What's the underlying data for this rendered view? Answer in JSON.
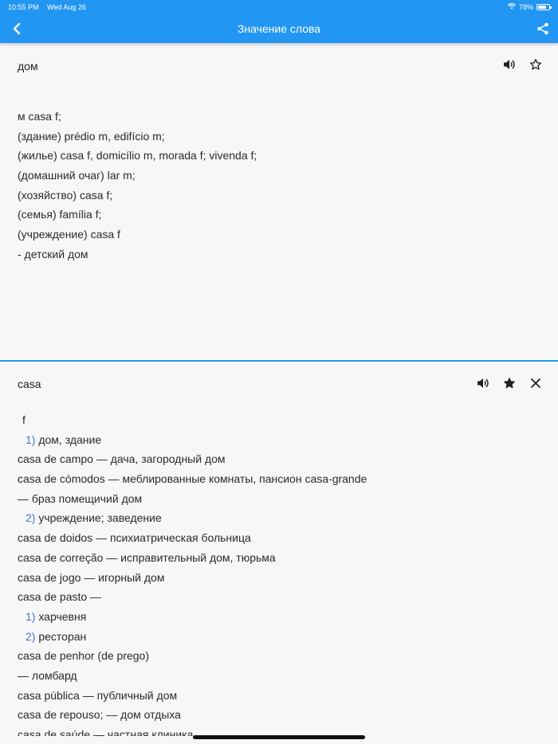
{
  "status": {
    "time": "10:55 PM",
    "date": "Wed Aug 26",
    "battery": "78%",
    "battery_level": 0.78
  },
  "appbar": {
    "title": "Значение слова",
    "back_icon": "chevron-left-icon",
    "share_icon": "share-icon"
  },
  "top_entry": {
    "word": "дом",
    "lines": [
      {
        "text": "м casa f;"
      },
      {
        "text": "(здание) prédio m, edifício m;"
      },
      {
        "text": "(жилье) casa f, domicílio m, morada f; vivenda f;"
      },
      {
        "text": "(домашний очаг) lar m;"
      },
      {
        "text": "(хозяйство) casa f;"
      },
      {
        "text": "(семья) família f;"
      },
      {
        "text": "(учреждение) casa f"
      },
      {
        "text": "- детский дом"
      }
    ]
  },
  "bottom_entry": {
    "word": "casa",
    "lines": [
      {
        "num": "",
        "text": "f"
      },
      {
        "num": "1)",
        "text": "дом, здание"
      },
      {
        "num": "",
        "text": "casa de campo — дача, загородный дом"
      },
      {
        "num": "",
        "text": "casa de cómodos — меблированные комнаты, пансион casa-grande"
      },
      {
        "num": "",
        "text": "— браз помещичий дом"
      },
      {
        "num": "2)",
        "text": "учреждение; заведение"
      },
      {
        "num": "",
        "text": "casa de doidos — психиатрическая больница"
      },
      {
        "num": "",
        "text": "casa de correção — исправительный дом, тюрьма"
      },
      {
        "num": "",
        "text": "casa de jogo — игорный дом"
      },
      {
        "num": "",
        "text": "casa de pasto —"
      },
      {
        "num": "1)",
        "text": "харчевня"
      },
      {
        "num": "2)",
        "text": "ресторан"
      },
      {
        "num": "",
        "text": "casa de penhor (de prego)"
      },
      {
        "num": "",
        "text": "— ломбард"
      },
      {
        "num": "",
        "text": "casa pública — публичный дом"
      },
      {
        "num": "",
        "text": "casa de repouso; — дом отдыха"
      },
      {
        "num": "",
        "text": "casa de saúde — частная клиника"
      }
    ]
  },
  "colors": {
    "accent": "#2196f3",
    "number": "#4a74d6"
  }
}
